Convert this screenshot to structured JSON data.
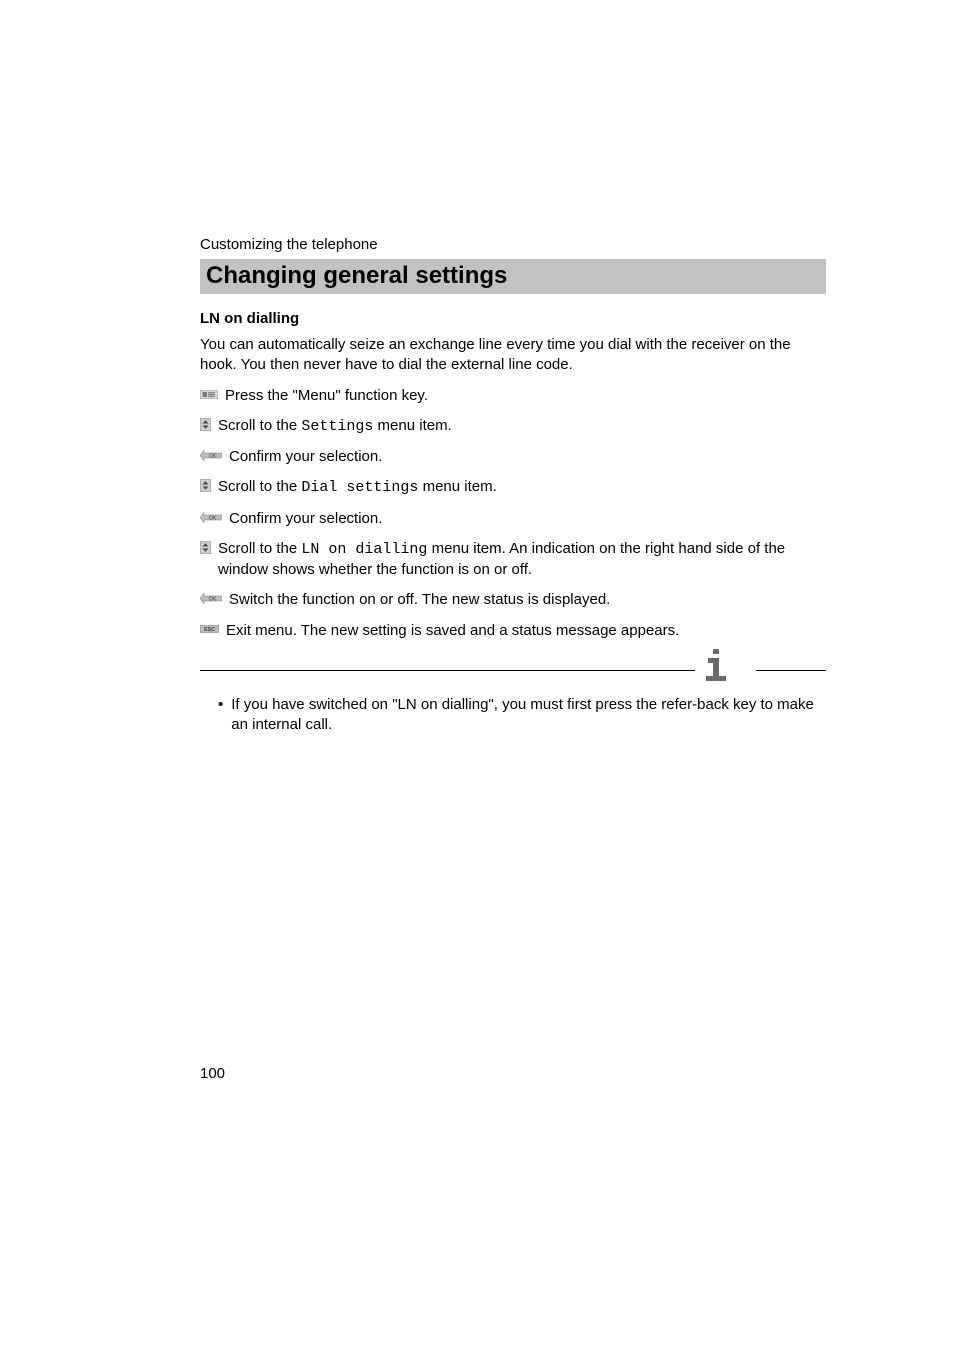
{
  "runningHead": "Customizing the telephone",
  "sectionTitle": "Changing general settings",
  "subTitle": "LN on dialling",
  "intro": "You can automatically seize an exchange line every time you dial with the receiver on the hook. You then never have to dial the external line code.",
  "steps": [
    {
      "icon": "menu",
      "parts": [
        {
          "t": "text",
          "v": "Press the \"Menu\" function key."
        }
      ]
    },
    {
      "icon": "scroll",
      "parts": [
        {
          "t": "text",
          "v": " Scroll to the "
        },
        {
          "t": "mono",
          "v": "Settings"
        },
        {
          "t": "text",
          "v": " menu item."
        }
      ]
    },
    {
      "icon": "ok",
      "parts": [
        {
          "t": "text",
          "v": " Confirm your selection."
        }
      ]
    },
    {
      "icon": "scroll",
      "parts": [
        {
          "t": "text",
          "v": " Scroll to the "
        },
        {
          "t": "mono",
          "v": "Dial settings"
        },
        {
          "t": "text",
          "v": " menu item."
        }
      ]
    },
    {
      "icon": "ok",
      "parts": [
        {
          "t": "text",
          "v": " Confirm your selection."
        }
      ]
    },
    {
      "icon": "scroll",
      "parts": [
        {
          "t": "text",
          "v": " Scroll to the "
        },
        {
          "t": "mono",
          "v": "LN on dialling"
        },
        {
          "t": "text",
          "v": " menu item. An indication on the right hand side of the window shows whether the function is on or off."
        }
      ]
    },
    {
      "icon": "ok",
      "parts": [
        {
          "t": "text",
          "v": " Switch the function on or off. The new status is displayed."
        }
      ]
    },
    {
      "icon": "esc",
      "parts": [
        {
          "t": "text",
          "v": " Exit menu. The new setting is saved and a status message appears."
        }
      ]
    }
  ],
  "notes": [
    "If you have switched on \"LN on dialling\", you must first press the refer-back key to make an internal call."
  ],
  "pageNumber": "100"
}
